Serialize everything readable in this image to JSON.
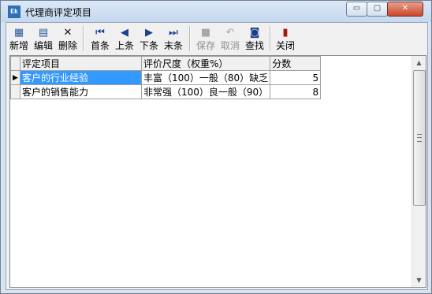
{
  "window": {
    "title": "代理商评定项目"
  },
  "title_buttons": {
    "minimize": "▭",
    "maximize": "▢",
    "close": "✕"
  },
  "toolbar": [
    {
      "id": "new",
      "label": "新增",
      "icon": "new-record-icon",
      "glyph": "▦",
      "enabled": true
    },
    {
      "id": "edit",
      "label": "编辑",
      "icon": "edit-icon",
      "glyph": "▤",
      "enabled": true
    },
    {
      "id": "delete",
      "label": "删除",
      "icon": "delete-icon",
      "glyph": "✕",
      "enabled": true
    },
    {
      "id": "first",
      "label": "首条",
      "icon": "first-record-icon",
      "glyph": "⏮",
      "enabled": true
    },
    {
      "id": "prev",
      "label": "上条",
      "icon": "previous-record-icon",
      "glyph": "◀",
      "enabled": true
    },
    {
      "id": "next",
      "label": "下条",
      "icon": "next-record-icon",
      "glyph": "▶",
      "enabled": true
    },
    {
      "id": "last",
      "label": "末条",
      "icon": "last-record-icon",
      "glyph": "⏭",
      "enabled": true
    },
    {
      "id": "save",
      "label": "保存",
      "icon": "save-icon",
      "glyph": "■",
      "enabled": false
    },
    {
      "id": "cancel",
      "label": "取消",
      "icon": "undo-icon",
      "glyph": "↶",
      "enabled": false
    },
    {
      "id": "find",
      "label": "查找",
      "icon": "binoculars-icon",
      "glyph": "◙",
      "enabled": true
    },
    {
      "id": "close",
      "label": "关闭",
      "icon": "exit-door-icon",
      "glyph": "▮",
      "enabled": true
    }
  ],
  "grid": {
    "columns": [
      "评定项目",
      "评价尺度（权重%）",
      "分数"
    ],
    "rows": [
      {
        "item": "客户的行业经验",
        "scale": "丰富（100）一般（80）缺乏",
        "score": "5",
        "selected": true
      },
      {
        "item": "客户的销售能力",
        "scale": "非常强（100）良一般（90）",
        "score": "8",
        "selected": false
      }
    ]
  },
  "colors": {
    "selection": "#3399ff",
    "title_gradient_top": "#dbe8f7",
    "close_button": "#c9462b"
  }
}
